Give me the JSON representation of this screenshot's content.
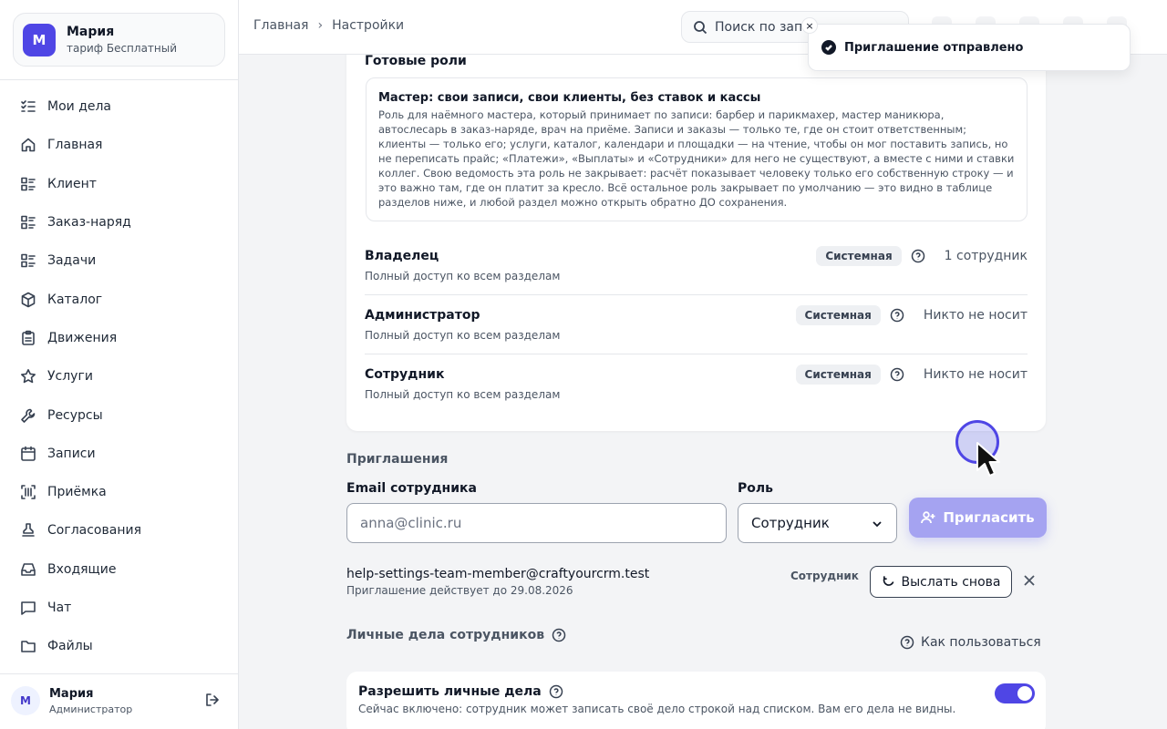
{
  "workspace": {
    "initial": "М",
    "name": "Мария",
    "plan": "тариф Бесплатный"
  },
  "sidebar": {
    "items": [
      {
        "label": "Мои дела",
        "icon": "checklist-icon"
      },
      {
        "label": "Главная",
        "icon": "home-icon"
      },
      {
        "label": "Клиент",
        "icon": "list-icon"
      },
      {
        "label": "Заказ-наряд",
        "icon": "list-icon"
      },
      {
        "label": "Задачи",
        "icon": "list-icon"
      },
      {
        "label": "Каталог",
        "icon": "box-icon"
      },
      {
        "label": "Движения",
        "icon": "clipboard-icon"
      },
      {
        "label": "Услуги",
        "icon": "star-icon"
      },
      {
        "label": "Ресурсы",
        "icon": "wrench-icon"
      },
      {
        "label": "Записи",
        "icon": "calendar-icon"
      },
      {
        "label": "Приёмка",
        "icon": "scan-icon"
      },
      {
        "label": "Согласования",
        "icon": "stamp-icon"
      },
      {
        "label": "Входящие",
        "icon": "inbox-icon"
      },
      {
        "label": "Чат",
        "icon": "chat-icon"
      },
      {
        "label": "Файлы",
        "icon": "folder-icon"
      }
    ],
    "user": {
      "initial": "М",
      "name": "Мария",
      "role": "Администратор"
    }
  },
  "topbar": {
    "breadcrumb": [
      "Главная",
      "Настройки"
    ],
    "search_text": "Поиск по запи"
  },
  "toast": {
    "message": "Приглашение отправлено",
    "close_glyph": "×"
  },
  "roles": {
    "ready_title": "Готовые роли",
    "preset": {
      "title": "Мастер: свои записи, свои клиенты, без ставок и кассы",
      "description": "Роль для наёмного мастера, который принимает по записи: барбер и парикмахер, мастер маникюра, автослесарь в заказ-наряде, врач на приёме. Записи и заказы — только те, где он стоит ответственным; клиенты — только его; услуги, каталог, календари и площадки — на чтение, чтобы он мог поставить запись, но не переписать прайс; «Платежи», «Выплаты» и «Сотрудники» для него не существуют, а вместе с ними и ставки коллег. Свою ведомость эта роль не закрывает: расчёт показывает человеку только его собственную строку — и это важно там, где он платит за кресло. Всё остальное роль закрывает по умолчанию — это видно в таблице разделов ниже, и любой раздел можно открыть обратно ДО сохранения."
    },
    "items": [
      {
        "name": "Владелец",
        "description": "Полный доступ ко всем разделам",
        "badge": "Системная",
        "count": "1 сотрудник"
      },
      {
        "name": "Администратор",
        "description": "Полный доступ ко всем разделам",
        "badge": "Системная",
        "count": "Никто не носит"
      },
      {
        "name": "Сотрудник",
        "description": "Полный доступ ко всем разделам",
        "badge": "Системная",
        "count": "Никто не носит"
      }
    ]
  },
  "invitations": {
    "title": "Приглашения",
    "email_label": "Email сотрудника",
    "email_placeholder": "anna@clinic.ru",
    "role_label": "Роль",
    "role_value": "Сотрудник",
    "invite_button": "Пригласить",
    "pending": {
      "email": "help-settings-team-member@craftyourcrm.test",
      "expires": "Приглашение действует до 29.08.2026",
      "role": "Сотрудник",
      "resend_button": "Выслать снова"
    }
  },
  "personal": {
    "title": "Личные дела сотрудников",
    "how_link": "Как пользоваться",
    "allow_title": "Разрешить личные дела",
    "allow_description": "Сейчас включено: сотрудник может записать своё дело строкой над списком. Вам его дела не видны.",
    "allow_enabled": true
  },
  "colors": {
    "accent": "#4f46e5",
    "invite_button_disabled": "#a5a3f1",
    "toggle_on": "#4f46e5"
  }
}
